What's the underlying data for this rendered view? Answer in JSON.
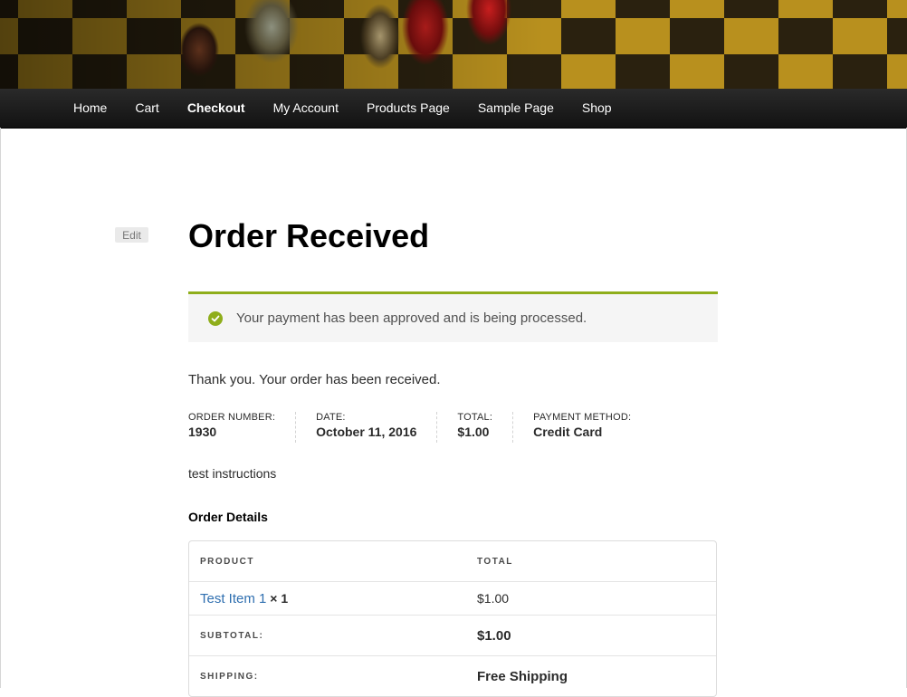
{
  "nav": {
    "items": [
      {
        "label": "Home"
      },
      {
        "label": "Cart"
      },
      {
        "label": "Checkout"
      },
      {
        "label": "My Account"
      },
      {
        "label": "Products Page"
      },
      {
        "label": "Sample Page"
      },
      {
        "label": "Shop"
      }
    ],
    "active": "Checkout"
  },
  "page": {
    "edit_label": "Edit",
    "title": "Order Received"
  },
  "notice": {
    "message": "Your payment has been approved and is being processed.",
    "accent_color": "#8fae1b",
    "icon": "check-circle-icon"
  },
  "thank_you": "Thank you. Your order has been received.",
  "overview": {
    "order_number_label": "ORDER NUMBER:",
    "order_number": "1930",
    "date_label": "DATE:",
    "date": "October 11, 2016",
    "total_label": "TOTAL:",
    "total": "$1.00",
    "payment_label": "PAYMENT METHOD:",
    "payment": "Credit Card"
  },
  "instructions": "test instructions",
  "order_details": {
    "title": "Order Details",
    "headers": {
      "product": "PRODUCT",
      "total": "TOTAL"
    },
    "items": [
      {
        "name": "Test Item 1",
        "qty": "× 1",
        "total": "$1.00"
      }
    ],
    "subtotal_label": "SUBTOTAL:",
    "subtotal": "$1.00",
    "shipping_label": "SHIPPING:",
    "shipping": "Free Shipping",
    "link_color": "#2f6fb0"
  }
}
